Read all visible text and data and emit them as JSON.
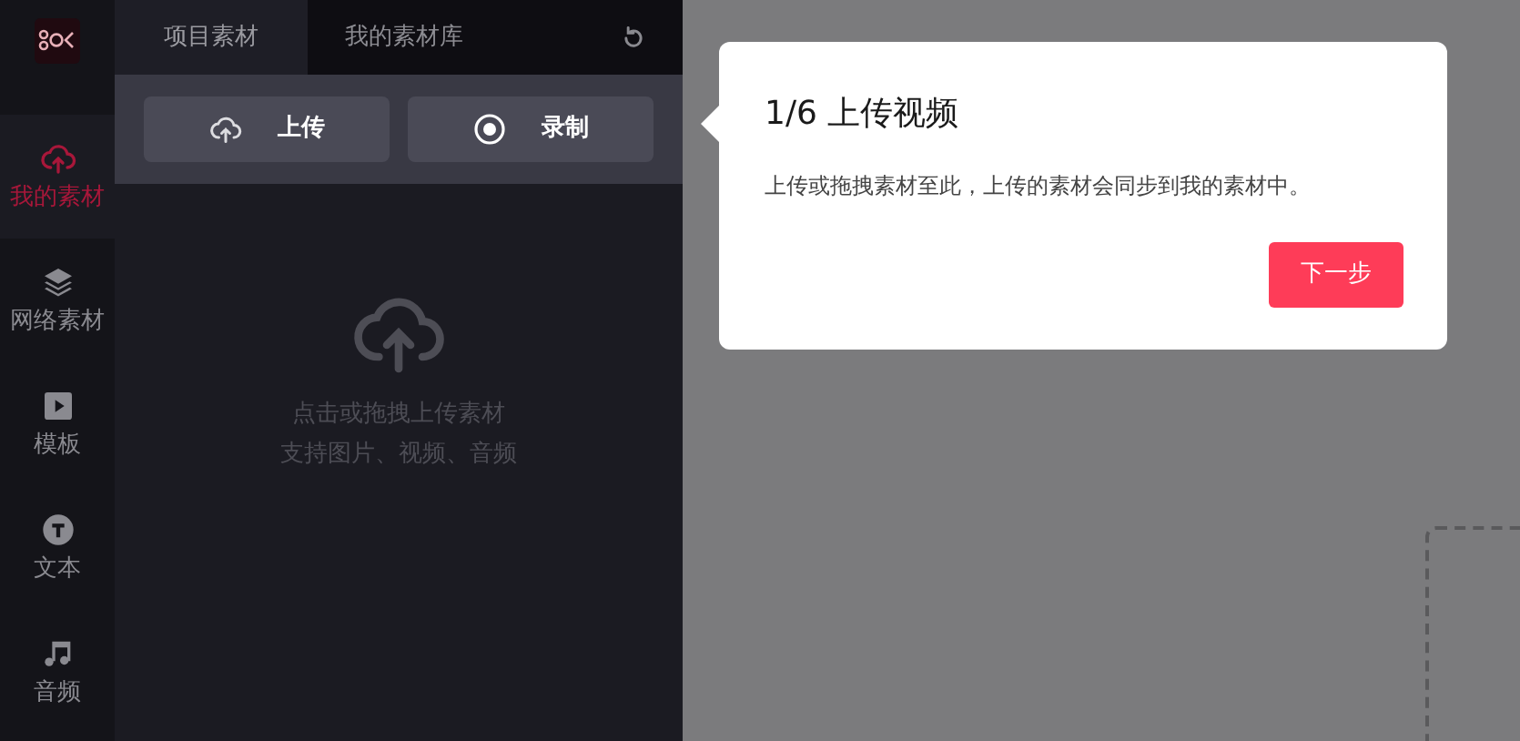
{
  "sidebar": {
    "items": [
      {
        "label": "我的素材",
        "selected": true
      },
      {
        "label": "网络素材",
        "selected": false
      },
      {
        "label": "模板",
        "selected": false
      },
      {
        "label": "文本",
        "selected": false
      },
      {
        "label": "音频",
        "selected": false
      }
    ]
  },
  "panel": {
    "tabs": [
      {
        "label": "项目素材",
        "selected": true
      },
      {
        "label": "我的素材库",
        "selected": false
      }
    ],
    "buttons": [
      "上传",
      "录制"
    ],
    "hint": [
      "点击或拖拽上传素材",
      "支持图片、视频、音频"
    ]
  },
  "popover": {
    "title": "1/6 上传视频",
    "body": "上传或拖拽素材至此，上传的素材会同步到我的素材中。",
    "button": "下一步"
  }
}
